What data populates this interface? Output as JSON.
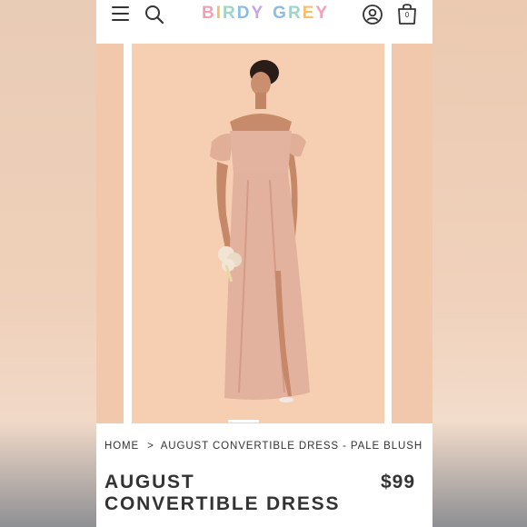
{
  "header": {
    "logo": [
      "B",
      "I",
      "R",
      "D",
      "Y",
      " ",
      "G",
      "R",
      "E",
      "Y"
    ],
    "logo_colors": [
      "#f2a0b5",
      "#f5c06b",
      "#9dd6c6",
      "#8bbce3",
      "#c7a5de",
      "#ffffff",
      "#8bbce3",
      "#9dd6c6",
      "#f5c06b",
      "#f2a0b5"
    ],
    "cart_count": "0"
  },
  "breadcrumb": {
    "home": "HOME",
    "separator": ">",
    "current": "AUGUST CONVERTIBLE DRESS - PALE BLUSH"
  },
  "product": {
    "title": "AUGUST CONVERTIBLE DRESS",
    "price": "$99"
  },
  "colors": {
    "slide_bg": "#f6cfb2",
    "dress": "#e3b29e",
    "text": "#333333"
  }
}
